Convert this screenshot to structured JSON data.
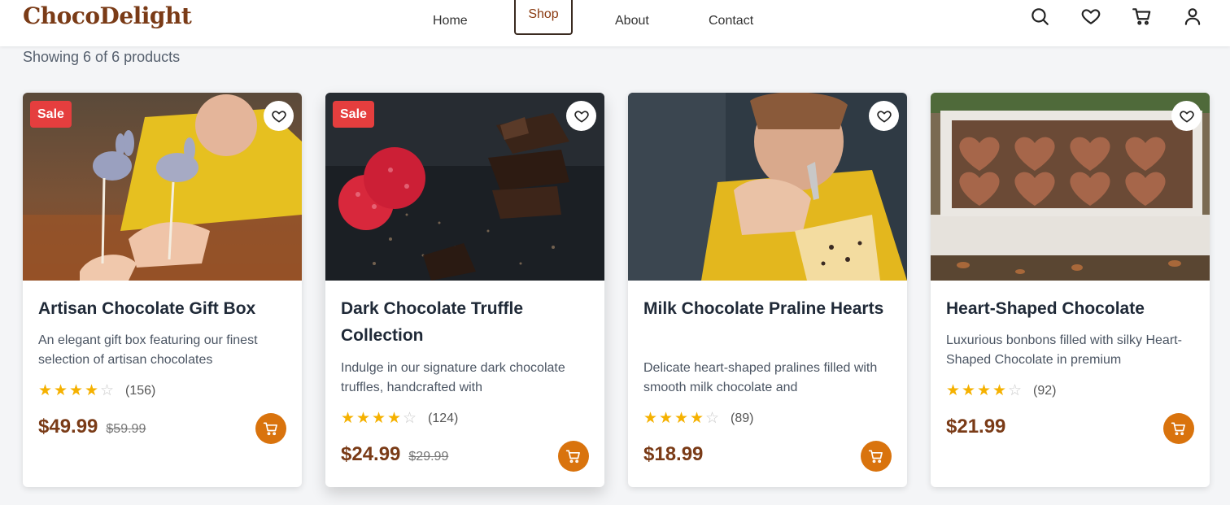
{
  "brand": {
    "name": "ChocoDelight",
    "color": "#7a3b17"
  },
  "nav": [
    {
      "label": "Home"
    },
    {
      "label": "Shop",
      "active": true
    },
    {
      "label": "About"
    },
    {
      "label": "Contact"
    }
  ],
  "header_icons": [
    "search-icon",
    "heart-icon",
    "cart-icon",
    "user-icon"
  ],
  "listing": {
    "count_text": "Showing 6 of 6 products"
  },
  "colors": {
    "accent": "#d9730d",
    "sale": "#e53e3e",
    "star": "#f5b100",
    "price": "#7a3b17"
  },
  "products": [
    {
      "title": "Artisan Chocolate Gift Box",
      "description": "An elegant gift box featuring our finest selection of artisan chocolates",
      "badge": "Sale",
      "rating": 4,
      "reviews": "(156)",
      "price": "$49.99",
      "old_price": "$59.99"
    },
    {
      "title": "Dark Chocolate Truffle Collection",
      "description": "Indulge in our signature dark chocolate truffles, handcrafted with",
      "badge": "Sale",
      "rating": 4,
      "reviews": "(124)",
      "price": "$24.99",
      "old_price": "$29.99"
    },
    {
      "title": "Milk Chocolate Praline Hearts",
      "description": "Delicate heart-shaped pralines filled with smooth milk chocolate and",
      "badge": "",
      "rating": 4,
      "reviews": "(89)",
      "price": "$18.99",
      "old_price": ""
    },
    {
      "title": "Heart-Shaped Chocolate",
      "description": "Luxurious bonbons filled with silky Heart-Shaped Chocolate in premium",
      "badge": "",
      "rating": 4,
      "reviews": "(92)",
      "price": "$21.99",
      "old_price": ""
    }
  ]
}
